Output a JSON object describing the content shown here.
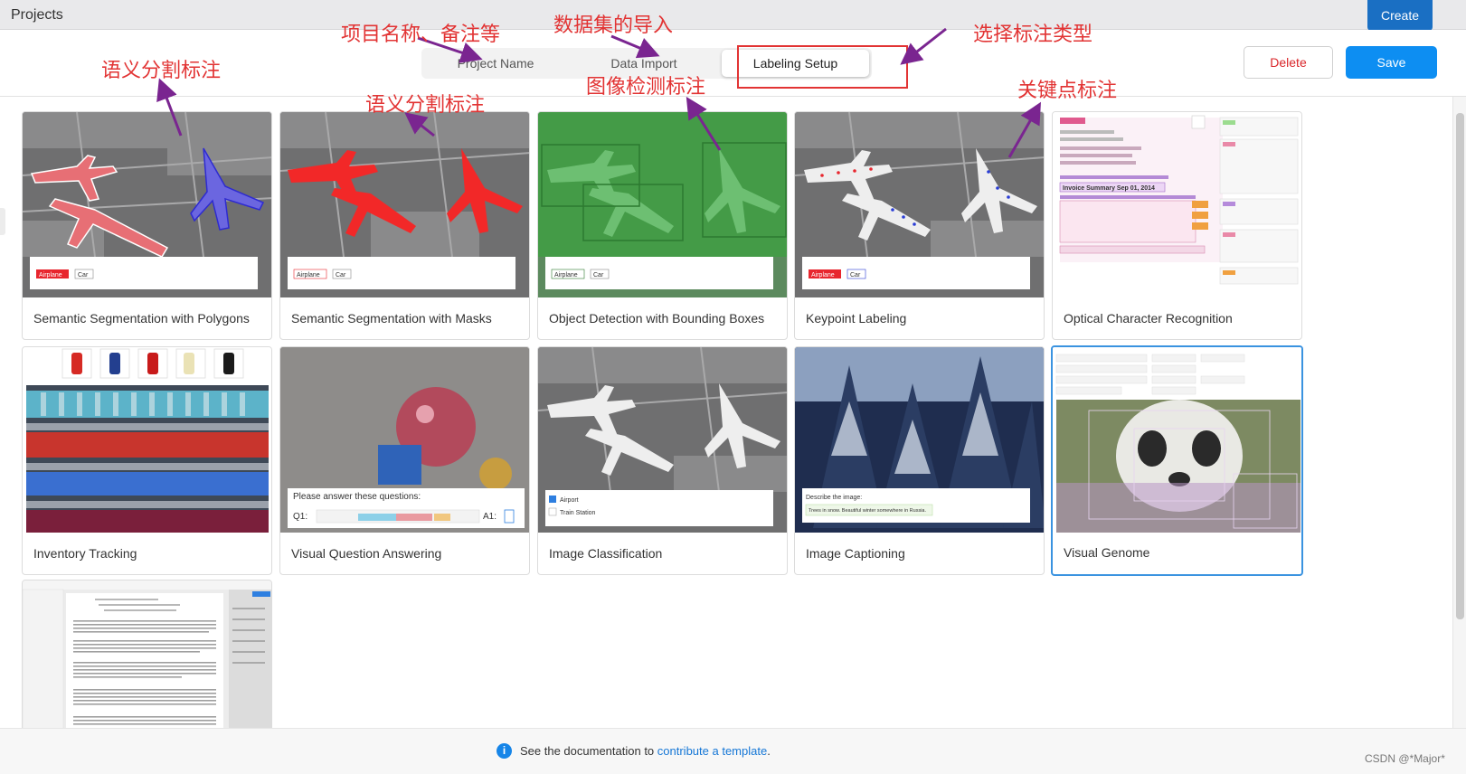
{
  "app": {
    "title": "Projects",
    "create_label": "Create"
  },
  "tabs": [
    {
      "label": "Project Name",
      "active": false
    },
    {
      "label": "Data Import",
      "active": false
    },
    {
      "label": "Labeling Setup",
      "active": true
    }
  ],
  "actions": {
    "delete_label": "Delete",
    "save_label": "Save"
  },
  "templates": [
    {
      "label": "Semantic Segmentation with Polygons",
      "tags": [
        "Airplane",
        "Car"
      ]
    },
    {
      "label": "Semantic Segmentation with Masks",
      "tags": [
        "Airplane",
        "Car"
      ]
    },
    {
      "label": "Object Detection with Bounding Boxes",
      "tags": [
        "Airplane",
        "Car"
      ]
    },
    {
      "label": "Keypoint Labeling",
      "tags": [
        "Airplane",
        "Car"
      ]
    },
    {
      "label": "Optical Character Recognition",
      "invoice_title": "Invoice Summary Sep 01, 2014"
    },
    {
      "label": "Inventory Tracking"
    },
    {
      "label": "Visual Question Answering",
      "prompt": "Please answer these questions:",
      "q1": "Q1:",
      "a1": "A1:"
    },
    {
      "label": "Image Classification",
      "choices": [
        "Airport",
        "Train Station"
      ]
    },
    {
      "label": "Image Captioning",
      "prompt": "Describe the image:",
      "caption": "Trees in snow. Beautiful winter somewhere in Russia."
    },
    {
      "label": "Visual Genome",
      "selected": true
    },
    {
      "label": ""
    }
  ],
  "footer": {
    "text_before": "See the documentation to ",
    "link": "contribute a template",
    "text_after": "."
  },
  "annotations": {
    "project_name": "项目名称、备注等",
    "data_import": "数据集的导入",
    "labeling_type": "选择标注类型",
    "semantic_seg_1": "语义分割标注",
    "semantic_seg_2": "语义分割标注",
    "object_detection": "图像检测标注",
    "keypoint": "关键点标注"
  },
  "watermark": "CSDN @*Major*",
  "colors": {
    "accent": "#0d8ef2",
    "danger": "#d9262a",
    "annotation": "#e23434",
    "arrow": "#7a2590"
  }
}
